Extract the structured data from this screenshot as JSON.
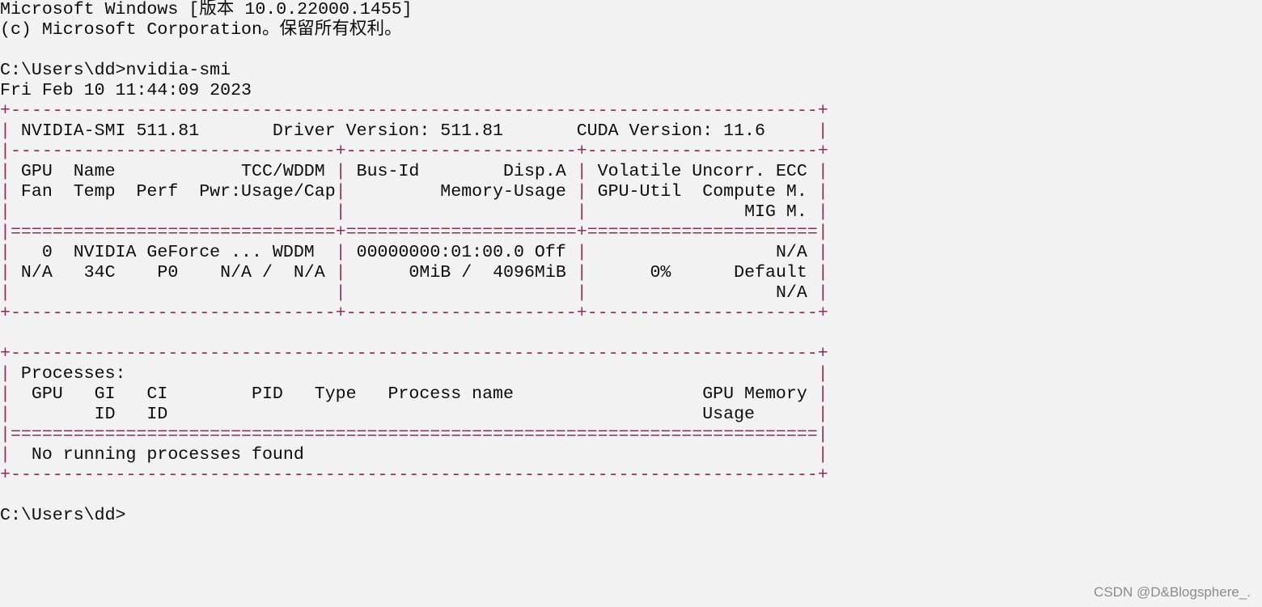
{
  "terminal": {
    "lines": [
      "Microsoft Windows [版本 10.0.22000.1455]",
      "(c) Microsoft Corporation。保留所有权利。",
      "",
      "C:\\Users\\dd>nvidia-smi",
      "Fri Feb 10 11:44:09 2023",
      "+-----------------------------------------------------------------------------+",
      "| NVIDIA-SMI 511.81       Driver Version: 511.81       CUDA Version: 11.6     |",
      "|-------------------------------+----------------------+----------------------+",
      "| GPU  Name            TCC/WDDM | Bus-Id        Disp.A | Volatile Uncorr. ECC |",
      "| Fan  Temp  Perf  Pwr:Usage/Cap|         Memory-Usage | GPU-Util  Compute M. |",
      "|                               |                      |               MIG M. |",
      "|===============================+======================+======================|",
      "|   0  NVIDIA GeForce ... WDDM  | 00000000:01:00.0 Off |                  N/A |",
      "| N/A   34C    P0    N/A /  N/A |      0MiB /  4096MiB |      0%      Default |",
      "|                               |                      |                  N/A |",
      "+-------------------------------+----------------------+----------------------+",
      "",
      "+-----------------------------------------------------------------------------+",
      "| Processes:                                                                  |",
      "|  GPU   GI   CI        PID   Type   Process name                  GPU Memory |",
      "|        ID   ID                                                   Usage      |",
      "|=============================================================================|",
      "|  No running processes found                                                 |",
      "+-----------------------------------------------------------------------------+",
      "",
      "C:\\Users\\dd>"
    ]
  },
  "watermark": "CSDN @D&Blogsphere_.",
  "colors": {
    "background": "#f2f2f2",
    "text": "#0c0c0c",
    "border": "#8a2f55"
  }
}
